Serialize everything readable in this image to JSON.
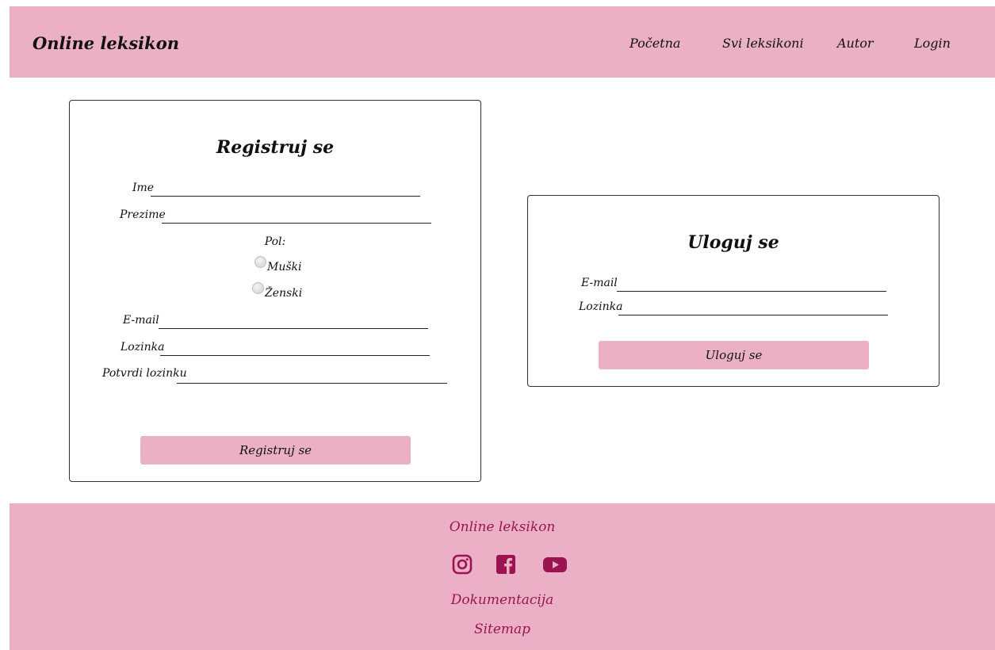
{
  "header": {
    "brand": "Online leksikon",
    "nav": [
      "Početna",
      "Svi leksikoni",
      "Autor",
      "Login"
    ]
  },
  "register": {
    "title": "Registruj se",
    "fields": {
      "first_name": "Ime",
      "last_name": "Prezime",
      "gender": "Pol:",
      "male": "Muški",
      "female": "Ženski",
      "email": "E-mail",
      "password": "Lozinka",
      "confirm_password": "Potvrdi lozinku"
    },
    "button": "Registruj se"
  },
  "login": {
    "title": "Uloguj se",
    "fields": {
      "email": "E-mail",
      "password": "Lozinka"
    },
    "button": "Uloguj se"
  },
  "footer": {
    "brand": "Online leksikon",
    "social_icons": [
      "instagram-icon",
      "facebook-icon",
      "youtube-icon"
    ],
    "links": [
      "Dokumentacija",
      "Sitemap"
    ]
  },
  "colors": {
    "accent_pink": "#ecb0c6",
    "footer_text": "#9b1451"
  }
}
